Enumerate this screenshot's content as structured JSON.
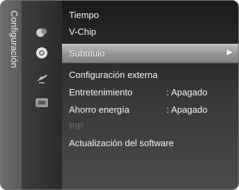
{
  "sidebar": {
    "category_label": "Configuración"
  },
  "icons": [
    "picture-icon",
    "settings-gear-icon",
    "satellite-dish-icon",
    "input-source-icon"
  ],
  "menu": {
    "items": [
      {
        "label": "Tiempo"
      },
      {
        "label": "V-Chip"
      },
      {
        "label": "Subtítulo",
        "arrow": "►"
      },
      {
        "label": "Configuración externa"
      },
      {
        "label": "Entretenimiento",
        "value": ": Apagado"
      },
      {
        "label": "Ahorro energía",
        "value": ": Apagado"
      },
      {
        "label": "PIP"
      },
      {
        "label": "Actualización del software"
      }
    ]
  },
  "colors": {
    "highlight": "#a5a5a5",
    "text": "#f4f4f4",
    "disabled_text": "#6b6b6b"
  }
}
